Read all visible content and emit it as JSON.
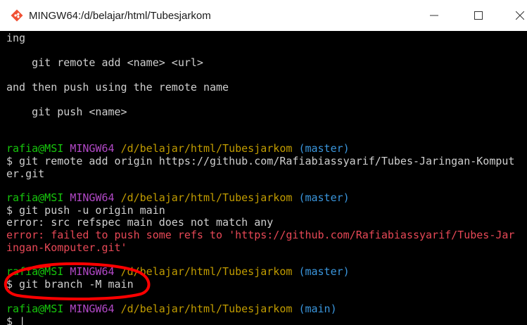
{
  "window": {
    "title": "MINGW64:/d/belajar/html/Tubesjarkom",
    "app_icon": "git-bash-icon",
    "controls": {
      "minimize_icon": "minimize-icon",
      "maximize_icon": "maximize-icon",
      "close_icon": "close-icon"
    }
  },
  "colors": {
    "background": "#000000",
    "text": "#cfcfcf",
    "prompt_user": "#16c60c",
    "prompt_env": "#b148c6",
    "prompt_path": "#c19c00",
    "prompt_branch": "#3a96dd",
    "error": "#e74856",
    "annotation": "#ff0000"
  },
  "terminal": {
    "help": {
      "line1": "ing",
      "line2": "    git remote add <name> <url>",
      "line3": "and then push using the remote name",
      "line4": "    git push <name>"
    },
    "block1": {
      "user": "rafia@MSI",
      "env": "MINGW64",
      "path": "/d/belajar/html/Tubesjarkom",
      "branch": "(master)",
      "cmd_line1": "$ git remote add origin https://github.com/Rafiabiassyarif/Tubes-Jaringan-Komput",
      "cmd_line2": "er.git"
    },
    "block2": {
      "user": "rafia@MSI",
      "env": "MINGW64",
      "path": "/d/belajar/html/Tubesjarkom",
      "branch": "(master)",
      "cmd": "$ git push -u origin main",
      "out1": "error: src refspec main does not match any",
      "err_line1": "error: failed to push some refs to 'https://github.com/Rafiabiassyarif/Tubes-Jar",
      "err_line2": "ingan-Komputer.git'"
    },
    "block3": {
      "user": "rafia@MSI",
      "env": "MINGW64",
      "path": "/d/belajar/html/Tubesjarkom",
      "branch": "(master)",
      "cmd": "$ git branch -M main"
    },
    "block4": {
      "user": "rafia@MSI",
      "env": "MINGW64",
      "path": "/d/belajar/html/Tubesjarkom",
      "branch": "(main)",
      "prompt": "$ "
    }
  }
}
